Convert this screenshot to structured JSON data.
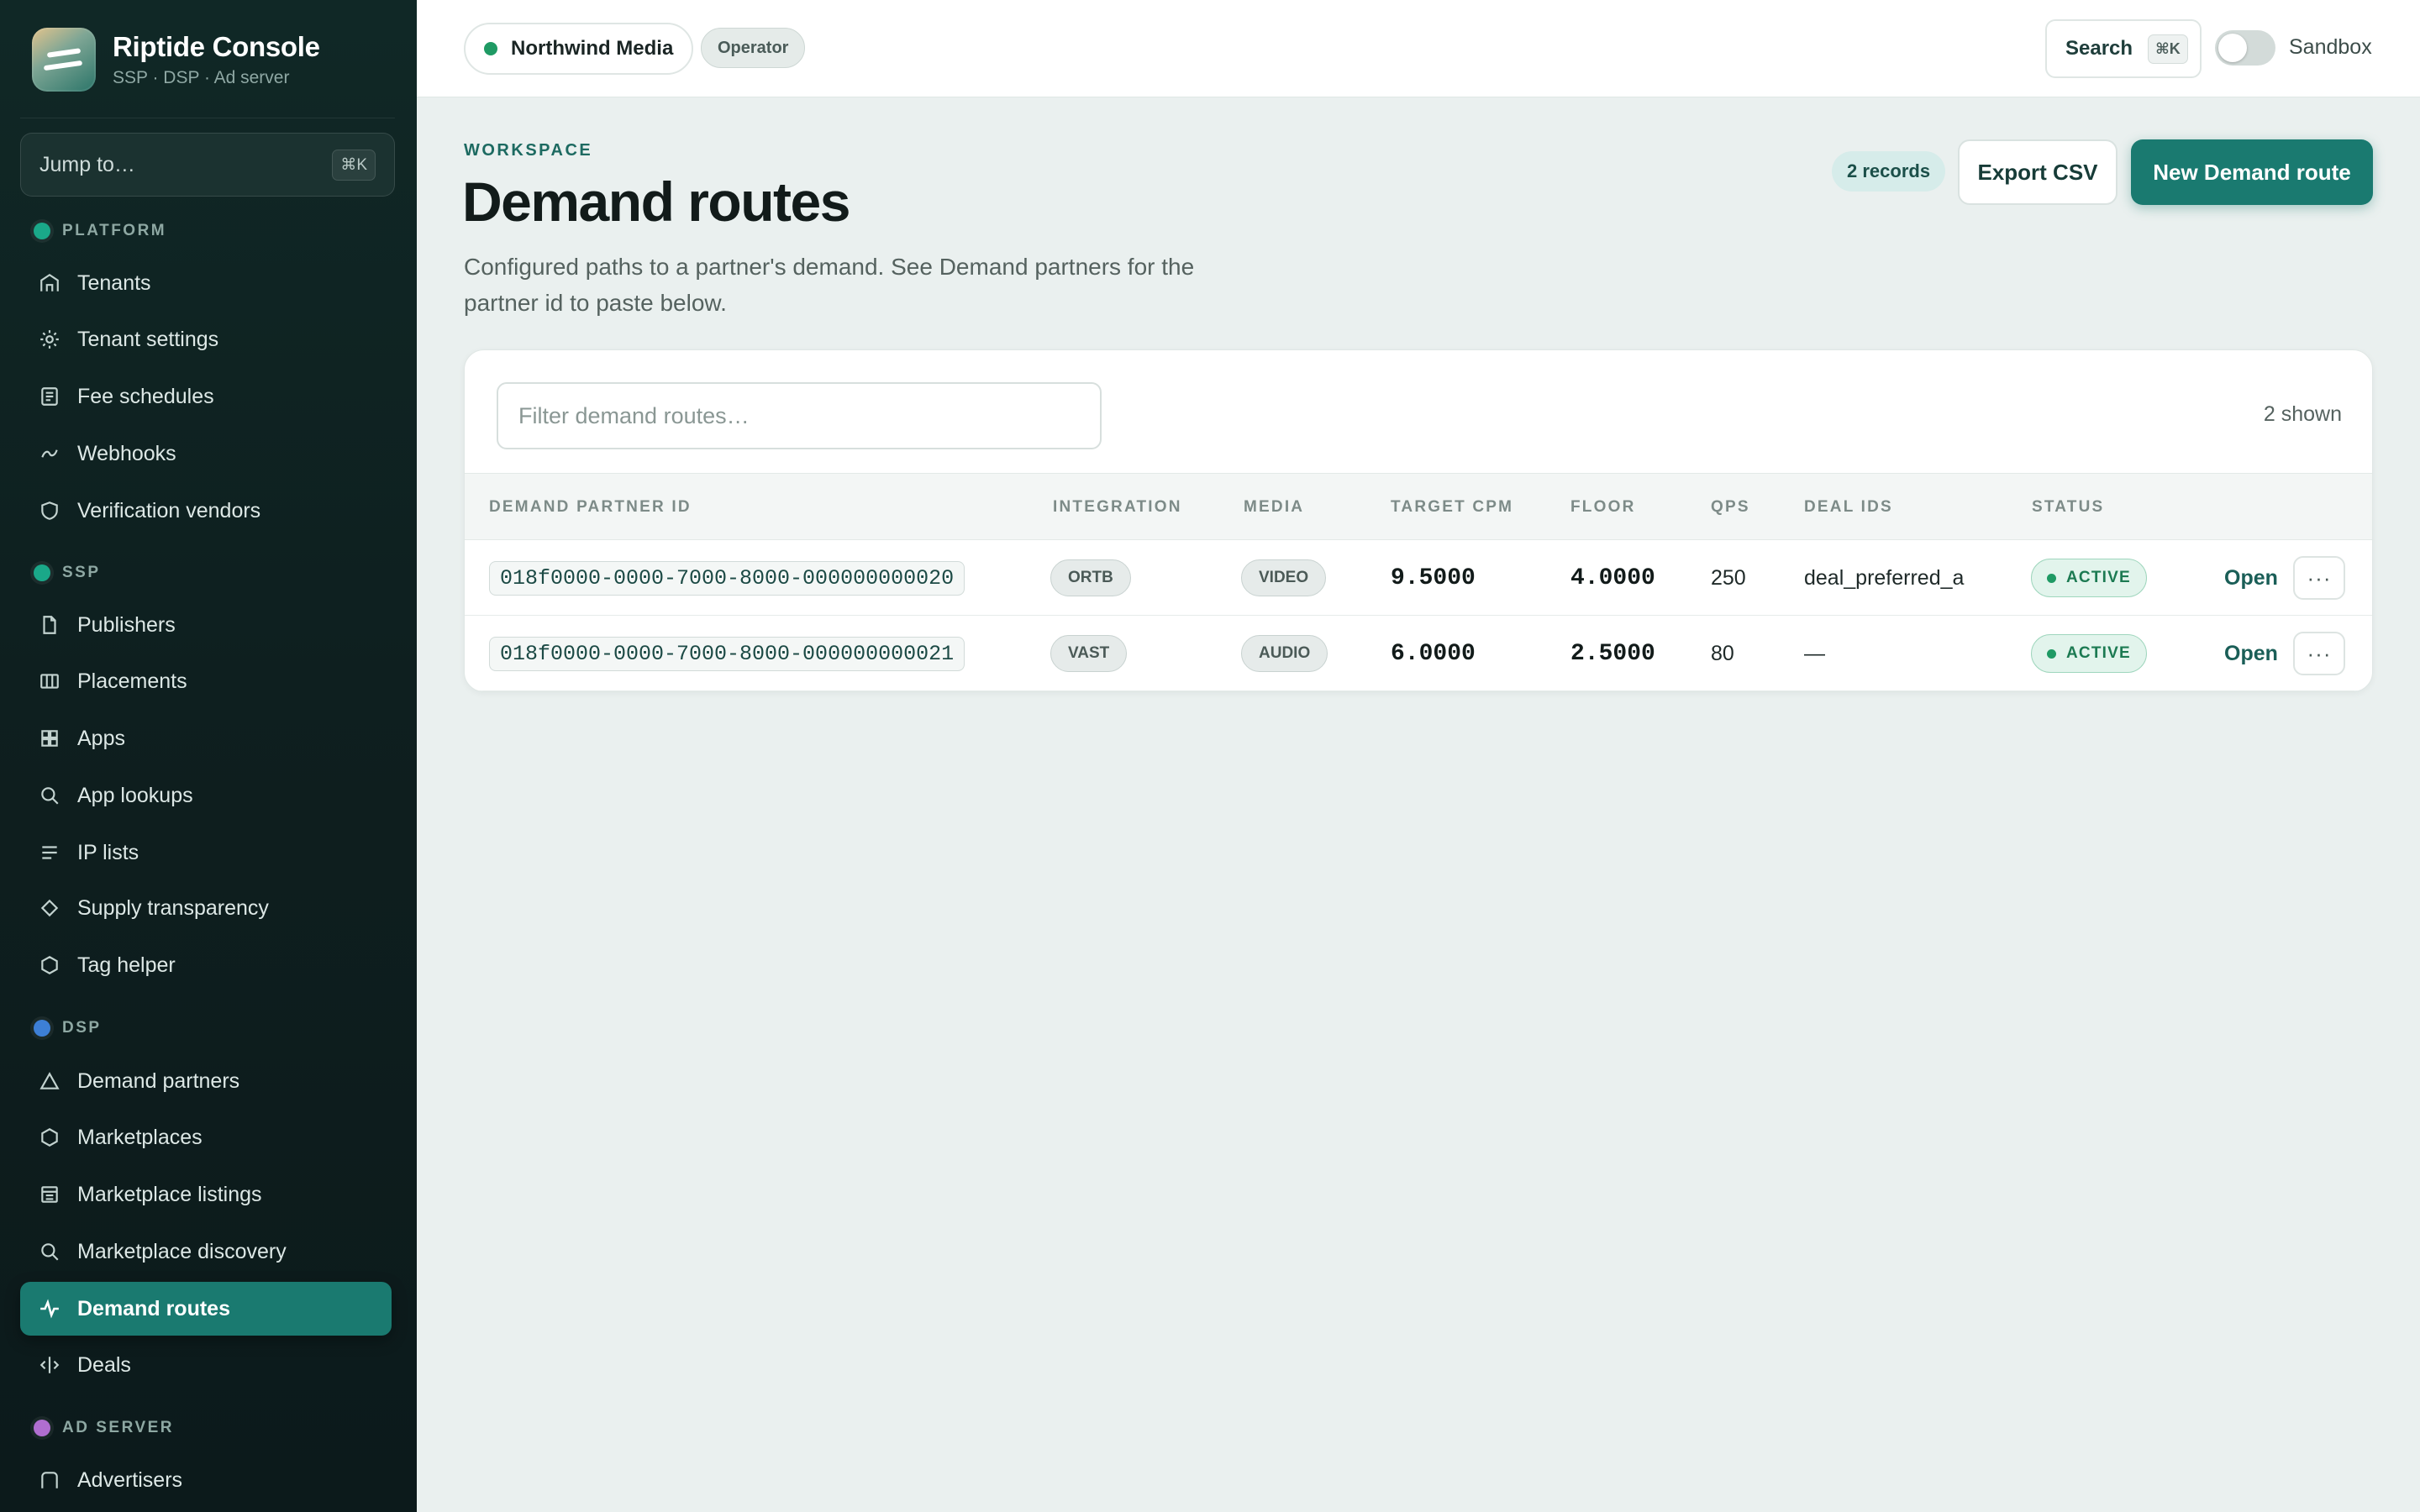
{
  "brand": {
    "title": "Riptide Console",
    "subtitle": "SSP · DSP · Ad server"
  },
  "jump": {
    "label": "Jump to…",
    "shortcut": "⌘K"
  },
  "sidebar": {
    "sections": [
      {
        "label": "PLATFORM",
        "dot_color": "#1aa889",
        "items": [
          {
            "label": "Tenants",
            "icon": "building-icon"
          },
          {
            "label": "Tenant settings",
            "icon": "gear-icon"
          },
          {
            "label": "Fee schedules",
            "icon": "receipt-icon"
          },
          {
            "label": "Webhooks",
            "icon": "webhook-icon"
          },
          {
            "label": "Verification vendors",
            "icon": "shield-icon"
          }
        ]
      },
      {
        "label": "SSP",
        "dot_color": "#1aa889",
        "items": [
          {
            "label": "Publishers",
            "icon": "file-icon"
          },
          {
            "label": "Placements",
            "icon": "columns-icon"
          },
          {
            "label": "Apps",
            "icon": "grid-icon"
          },
          {
            "label": "App lookups",
            "icon": "search-icon"
          },
          {
            "label": "IP lists",
            "icon": "list-icon"
          },
          {
            "label": "Supply transparency",
            "icon": "diamond-icon"
          },
          {
            "label": "Tag helper",
            "icon": "hexagon-icon"
          }
        ]
      },
      {
        "label": "DSP",
        "dot_color": "#3d7fd6",
        "items": [
          {
            "label": "Demand partners",
            "icon": "triangle-icon"
          },
          {
            "label": "Marketplaces",
            "icon": "hexagon-icon"
          },
          {
            "label": "Marketplace listings",
            "icon": "listing-icon"
          },
          {
            "label": "Marketplace discovery",
            "icon": "search-icon"
          },
          {
            "label": "Demand routes",
            "icon": "pulse-icon"
          },
          {
            "label": "Deals",
            "icon": "deals-icon"
          }
        ]
      },
      {
        "label": "AD SERVER",
        "dot_color": "#b06ed0",
        "items": [
          {
            "label": "Advertisers",
            "icon": "building-icon"
          }
        ]
      }
    ],
    "active_item": "Demand routes"
  },
  "topbar": {
    "tenant": "Northwind Media",
    "role": "Operator",
    "search_label": "Search",
    "search_shortcut": "⌘K",
    "sandbox_label": "Sandbox",
    "sandbox_enabled": false
  },
  "page": {
    "eyebrow": "WORKSPACE",
    "title": "Demand routes",
    "description": "Configured paths to a partner's demand. See Demand partners for the partner id to paste below.",
    "records_badge": "2 records",
    "export_label": "Export CSV",
    "new_label": "New Demand route"
  },
  "table": {
    "filter_placeholder": "Filter demand routes…",
    "shown_count": "2 shown",
    "columns": [
      "DEMAND PARTNER ID",
      "INTEGRATION",
      "MEDIA",
      "TARGET CPM",
      "FLOOR",
      "QPS",
      "DEAL IDS",
      "STATUS"
    ],
    "rows": [
      {
        "partner_id": "018f0000-0000-7000-8000-000000000020",
        "integration": "ORTB",
        "media": "VIDEO",
        "target_cpm": "9.5000",
        "floor": "4.0000",
        "qps": "250",
        "deal_ids": "deal_preferred_a",
        "status": "ACTIVE",
        "action": "Open",
        "more": "···"
      },
      {
        "partner_id": "018f0000-0000-7000-8000-000000000021",
        "integration": "VAST",
        "media": "AUDIO",
        "target_cpm": "6.0000",
        "floor": "2.5000",
        "qps": "80",
        "deal_ids": "—",
        "status": "ACTIVE",
        "action": "Open",
        "more": "···"
      }
    ]
  }
}
